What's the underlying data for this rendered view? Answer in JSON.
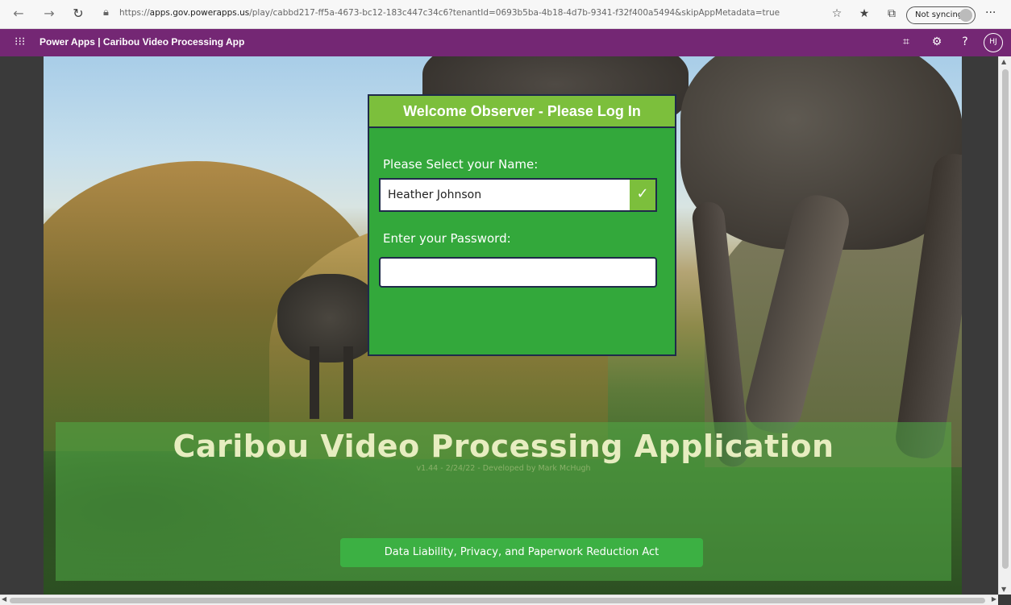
{
  "browser": {
    "url_prefix": "https://",
    "url_host": "apps.gov.powerapps.us",
    "url_path": "/play/cabbd217-ff5a-4673-bc12-183c447c34c6?tenantId=0693b5ba-4b18-4d7b-9341-f32f400a5494&skipAppMetadata=true",
    "sync_label": "Not syncing",
    "icons": [
      "back-icon",
      "forward-icon",
      "refresh-icon",
      "lock-icon",
      "read-aloud-icon",
      "favorites-icon",
      "collections-icon",
      "profile-icon",
      "more-icon"
    ]
  },
  "app_bar": {
    "title": "Power Apps | Caribou Video Processing App",
    "user_initials": "HJ",
    "background_color": "#742774"
  },
  "login": {
    "title": "Welcome Observer - Please Log In",
    "name_label": "Please Select your Name:",
    "selected_name": "Heather Johnson",
    "password_label": "Enter your Password:",
    "password_value": ""
  },
  "banner": {
    "title": "Caribou Video Processing Application",
    "subtitle": "v1.44  -  2/24/22  -  Developed by Mark McHugh",
    "button_label": "Data Liability, Privacy, and Paperwork Reduction Act"
  },
  "colors": {
    "panel_green": "#33a83b",
    "header_green": "#7cbf3c",
    "border_navy": "#1f2a4a"
  }
}
